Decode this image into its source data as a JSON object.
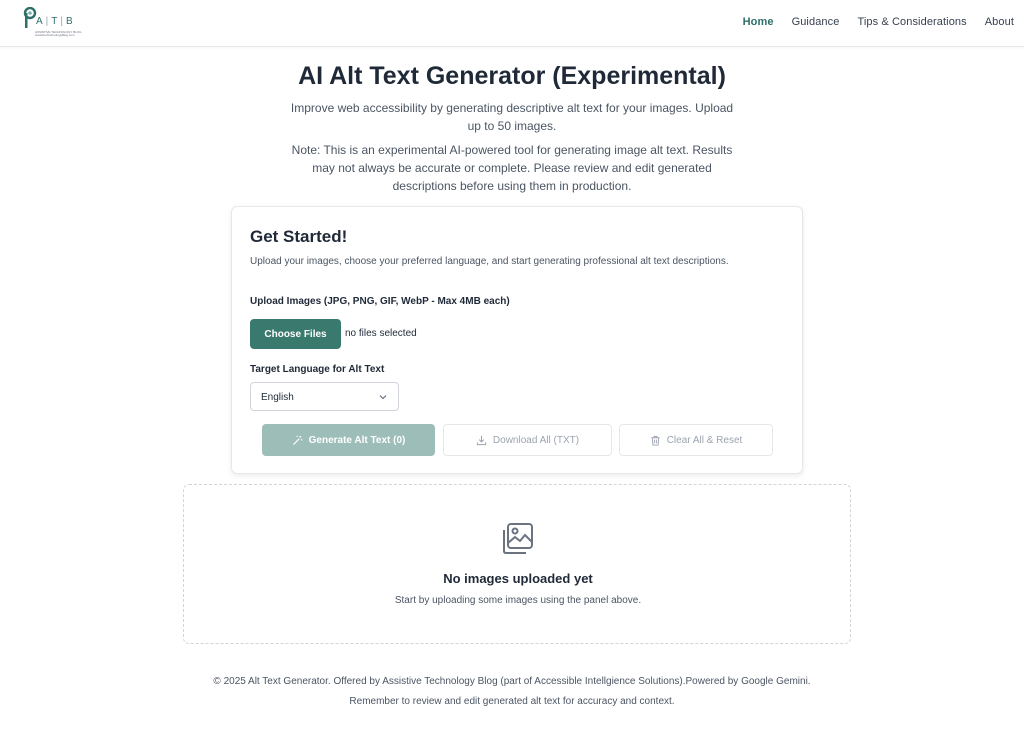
{
  "header": {
    "logo_letters": [
      "A",
      "T",
      "B"
    ],
    "logo_tagline": "ASSISTIVE TECHNOLOGY BLOG",
    "logo_url_text": "AssistiveTechnologyBlog.com",
    "nav": [
      {
        "label": "Home",
        "active": true
      },
      {
        "label": "Guidance",
        "active": false
      },
      {
        "label": "Tips & Considerations",
        "active": false
      },
      {
        "label": "About",
        "active": false
      }
    ]
  },
  "hero": {
    "title": "AI Alt Text Generator (Experimental)",
    "subtitle": "Improve web accessibility by generating descriptive alt text for your images. Upload up to 50 images.",
    "note": "Note: This is an experimental AI-powered tool for generating image alt text. Results may not always be accurate or complete. Please review and edit generated descriptions before using them in production."
  },
  "card": {
    "title": "Get Started!",
    "description": "Upload your images, choose your preferred language, and start generating professional alt text descriptions.",
    "upload_label": "Upload Images (JPG, PNG, GIF, WebP - Max 4MB each)",
    "choose_button": "Choose Files",
    "file_status": "no files selected",
    "language_label": "Target Language for Alt Text",
    "language_value": "English",
    "generate_button": "Generate Alt Text (0)",
    "download_button": "Download All (TXT)",
    "clear_button": "Clear All & Reset"
  },
  "empty_state": {
    "title": "No images uploaded yet",
    "description": "Start by uploading some images using the panel above."
  },
  "footer": {
    "main": "© 2025 Alt Text Generator. Offered by Assistive Technology Blog (part of Accessible Intellgience Solutions).Powered by Google Gemini.",
    "remind": "Remember to review and edit generated alt text for accuracy and context."
  },
  "colors": {
    "accent": "#3a7a6e",
    "accent_disabled": "#9dbdb8",
    "nav_active": "#2f6f6a"
  },
  "icons": {
    "generate": "magic-wand-icon",
    "download": "download-icon",
    "clear": "trash-icon",
    "empty": "images-icon",
    "select": "chevron-down-icon"
  }
}
